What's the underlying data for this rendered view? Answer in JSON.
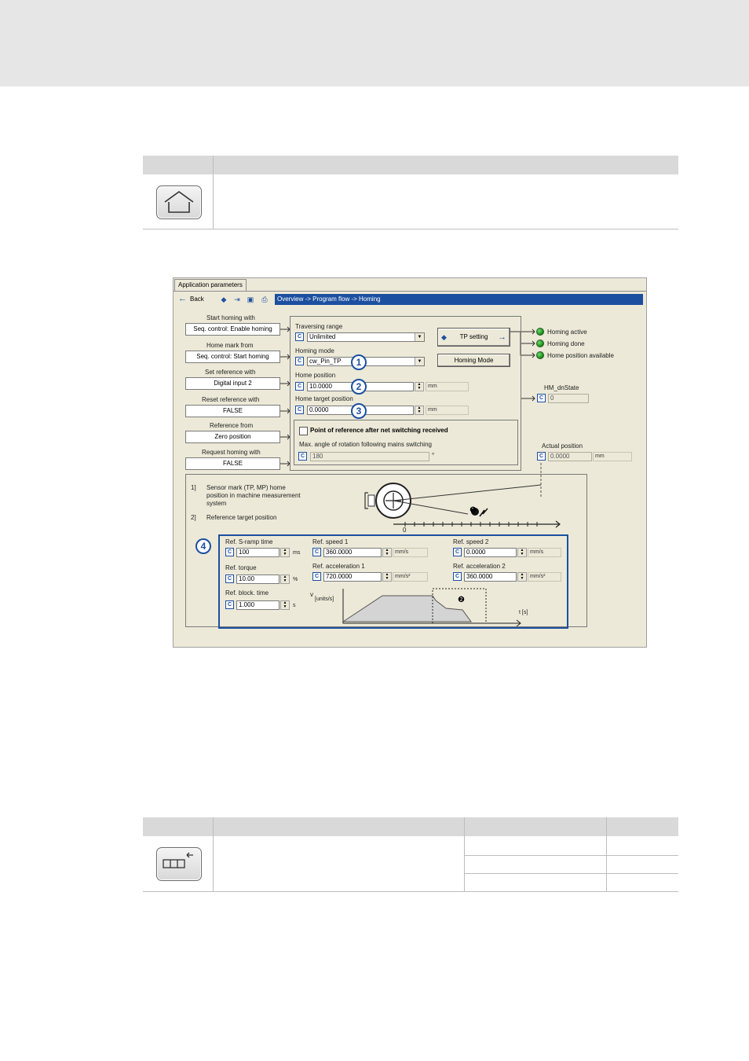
{
  "screen": {
    "tab_label": "Application parameters",
    "back_label": "Back",
    "breadcrumb": "Overview -> Program flow -> Homing",
    "icons": [
      "back-arrow-icon",
      "info-icon",
      "import-icon",
      "terminal-icon",
      "print-icon"
    ],
    "left_column": [
      {
        "title": "Start homing with",
        "value": "Seq. control: Enable homing"
      },
      {
        "title": "Home mark from",
        "value": "Seq. control: Start homing"
      },
      {
        "title": "Set reference with",
        "value": "Digital input 2"
      },
      {
        "title": "Reset reference with",
        "value": "FALSE"
      },
      {
        "title": "Reference from",
        "value": "Zero position"
      },
      {
        "title": "Request homing with",
        "value": "FALSE"
      }
    ],
    "params": {
      "traversing_range_label": "Traversing range",
      "traversing_range_value": "Unlimited",
      "homing_mode_label": "Homing mode",
      "homing_mode_value": "cw_Pin_TP",
      "home_position_label": "Home position",
      "home_position_value": "10.0000",
      "home_position_unit": "mm",
      "home_target_label": "Home target position",
      "home_target_value": "0.0000",
      "home_target_unit": "mm",
      "checkbox_label": "Point of reference after net switching received",
      "max_angle_label": "Max. angle of rotation following mains switching",
      "max_angle_value": "180",
      "max_angle_unit": "°",
      "c_label": "C"
    },
    "buttons": {
      "tp_setting": "TP setting",
      "homing_mode": "Homing Mode"
    },
    "status": [
      {
        "label": "Homing active",
        "color": "#1a9a1a"
      },
      {
        "label": "Homing done",
        "color": "#1a9a1a"
      },
      {
        "label": "Home position available",
        "color": "#1a9a1a"
      }
    ],
    "hm_state": {
      "label": "HM_dnState",
      "value": "0"
    },
    "actual_position": {
      "label": "Actual position",
      "value": "0.0000",
      "unit": "mm"
    },
    "legend": {
      "item1_num": "1]",
      "item1_text1": "Sensor mark (TP, MP) home",
      "item1_text2": "position in machine measurement",
      "item1_text3": "system",
      "item2_num": "2]",
      "item2_text": "Reference target position",
      "axis_zero": "0"
    },
    "callouts": [
      "1",
      "2",
      "3",
      "4"
    ],
    "markers": [
      "❶",
      "❷"
    ],
    "bottom_params": {
      "s_ramp_label": "Ref. S-ramp time",
      "s_ramp_value": "100",
      "s_ramp_unit": "ms",
      "torque_label": "Ref. torque",
      "torque_value": "10.00",
      "torque_unit": "%",
      "block_label": "Ref. block. time",
      "block_value": "1.000",
      "block_unit": "s",
      "speed1_label": "Ref. speed 1",
      "speed1_value": "360.0000",
      "speed1_unit": "mm/s",
      "acc1_label": "Ref. acceleration 1",
      "acc1_value": "720.0000",
      "acc1_unit": "mm/s²",
      "speed2_label": "Ref. speed 2",
      "speed2_value": "0.0000",
      "speed2_unit": "mm/s",
      "acc2_label": "Ref. acceleration 2",
      "acc2_value": "360.0000",
      "acc2_unit": "mm/s²",
      "v_label": "v",
      "v_unit": "[units/s]",
      "t_label": "t [s]"
    }
  },
  "colors": {
    "accent": "#1c4fa0",
    "window_bg": "#ece9d8",
    "table_header": "#d9d9d9",
    "top_band": "#e6e6e6"
  }
}
